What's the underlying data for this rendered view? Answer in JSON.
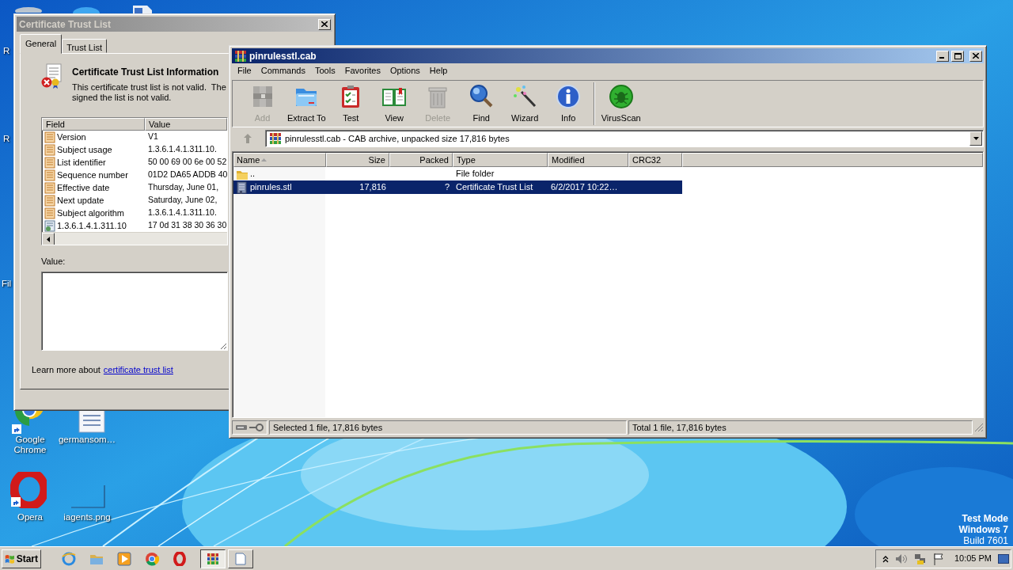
{
  "desktop": {
    "icons": [
      {
        "label": "R"
      },
      {
        "label": "R"
      },
      {
        "label": "Fil"
      },
      {
        "label": "Google Chrome"
      },
      {
        "label": "germansom…"
      },
      {
        "label": "Opera"
      },
      {
        "label": "iagents.png"
      }
    ],
    "os_notice": [
      "Test Mode",
      "Windows 7",
      "Build 7601"
    ]
  },
  "cert_dialog": {
    "title": "Certificate Trust List",
    "tabs": [
      {
        "label": "General",
        "selected": true
      },
      {
        "label": "Trust List",
        "selected": false
      }
    ],
    "heading": "Certificate Trust List Information",
    "message": [
      "This certificate trust list is not valid.  The",
      "signed the list is not valid."
    ],
    "columns": [
      "Field",
      "Value"
    ],
    "rows": [
      {
        "kind": "property",
        "field": "Version",
        "value": "V1"
      },
      {
        "kind": "property",
        "field": "Subject usage",
        "value": "1.3.6.1.4.1.311.10."
      },
      {
        "kind": "property",
        "field": "List identifier",
        "value": "50 00 69 00 6e 00 52"
      },
      {
        "kind": "property",
        "field": "Sequence number",
        "value": "01D2 DA65 ADDB 40"
      },
      {
        "kind": "property",
        "field": "Effective date",
        "value": "Thursday, June 01,"
      },
      {
        "kind": "property",
        "field": "Next update",
        "value": "Saturday, June 02,"
      },
      {
        "kind": "property",
        "field": "Subject algorithm",
        "value": "1.3.6.1.4.1.311.10."
      },
      {
        "kind": "extension",
        "field": "1.3.6.1.4.1.311.10",
        "value": "17 0d 31 38 30 36 30"
      }
    ],
    "value_label": "Value:",
    "footer_text": "Learn more about",
    "footer_link": "certificate trust list"
  },
  "archiver": {
    "title": "pinrulesstl.cab",
    "menu": [
      "File",
      "Commands",
      "Tools",
      "Favorites",
      "Options",
      "Help"
    ],
    "toolbar": [
      {
        "label": "Add",
        "disabled": true
      },
      {
        "label": "Extract To",
        "disabled": false
      },
      {
        "label": "Test",
        "disabled": false
      },
      {
        "label": "View",
        "disabled": false
      },
      {
        "label": "Delete",
        "disabled": true
      },
      {
        "label": "Find",
        "disabled": false
      },
      {
        "label": "Wizard",
        "disabled": false
      },
      {
        "label": "Info",
        "disabled": false
      },
      {
        "label": "VirusScan",
        "disabled": false
      }
    ],
    "address": "pinrulesstl.cab - CAB archive, unpacked size 17,816 bytes",
    "columns": [
      {
        "label": "Name",
        "sorted": true
      },
      {
        "label": "Size",
        "sorted": false
      },
      {
        "label": "Packed",
        "sorted": false
      },
      {
        "label": "Type",
        "sorted": false
      },
      {
        "label": "Modified",
        "sorted": false
      },
      {
        "label": "CRC32",
        "sorted": false
      }
    ],
    "rows": [
      {
        "kind": "folder",
        "name": "..",
        "type": "File folder",
        "selected": false
      },
      {
        "kind": "file",
        "name": "pinrules.stl",
        "size": "17,816",
        "packed": "?",
        "type": "Certificate Trust List",
        "modified": "6/2/2017 10:22…",
        "selected": true
      }
    ],
    "status": [
      "Selected 1 file, 17,816 bytes",
      "Total 1 file, 17,816 bytes"
    ]
  },
  "taskbar": {
    "start": "Start",
    "tasks": [
      {
        "selected": true
      },
      {
        "selected": false
      }
    ],
    "clock": "10:05 PM"
  }
}
